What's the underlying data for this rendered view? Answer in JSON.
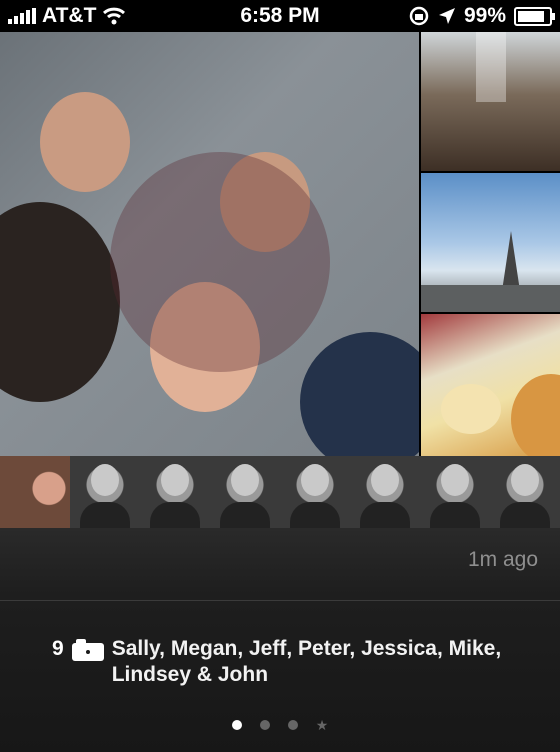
{
  "status_bar": {
    "carrier": "AT&T",
    "time": "6:58 PM",
    "battery": "99%",
    "battery_level": 0.99
  },
  "collage": {
    "photos": [
      "group-selfie",
      "market-hall",
      "city-skyline",
      "cheese-counter"
    ]
  },
  "faces_strip": {
    "count": 8
  },
  "post": {
    "time_ago": "1m ago",
    "photo_count": "9",
    "people": "Sally, Megan, Jeff, Peter, Jessica, Mike, Lindsey & John"
  },
  "pager": {
    "pages": 4,
    "active_index": 0
  }
}
